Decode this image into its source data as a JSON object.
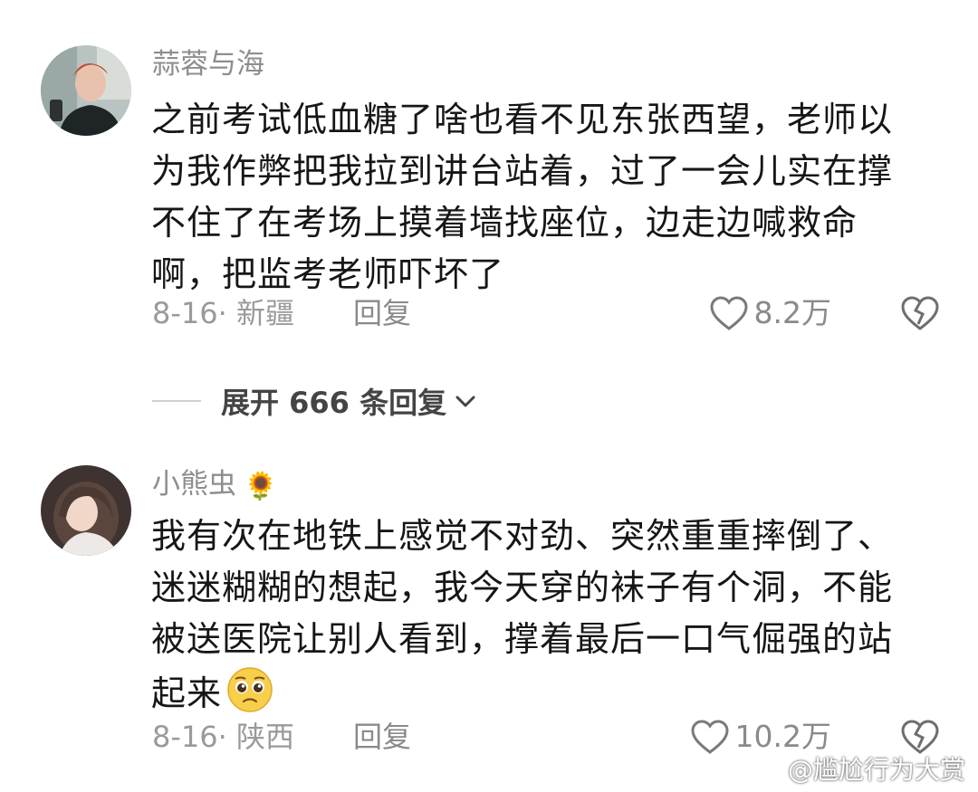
{
  "comments": [
    {
      "username": "蒜蓉与海",
      "text": "之前考试低血糖了啥也看不见东张西望，老师以为我作弊把我拉到讲台站着，过了一会儿实在撑不住了在考场上摸着墙找座位，边走边喊救命啊，把监考老师吓坏了",
      "date_location": "8-16· 新疆",
      "reply_label": "回复",
      "likes": "8.2万",
      "avatar_icon": "user-photo-avatar"
    },
    {
      "username": "小熊虫",
      "username_emoji": "🌻",
      "text": "我有次在地铁上感觉不对劲、突然重重摔倒了、迷迷糊糊的想起，我今天穿的袜子有个洞，不能被送医院让别人看到，撑着最后一口气倔强的站起来",
      "date_location": "8-16· 陕西",
      "reply_label": "回复",
      "likes": "10.2万",
      "avatar_icon": "user-photo-avatar",
      "trailing_emoji": "pleading-face-emoji"
    }
  ],
  "expand_replies": {
    "label": "展开 666 条回复"
  },
  "watermark": {
    "text": "@尴尬行为大赏",
    "icon": "weibo-icon"
  },
  "colors": {
    "text_primary": "#161616",
    "text_muted": "#8e8e8e",
    "background": "#ffffff"
  }
}
